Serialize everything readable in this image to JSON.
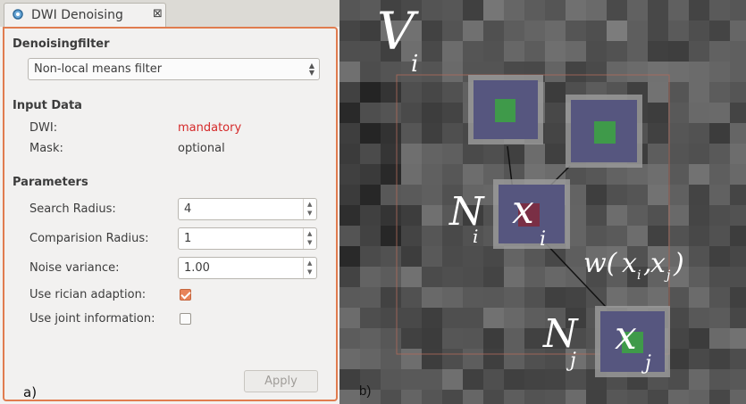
{
  "tab": {
    "title": "DWI Denoising",
    "close": "⊠"
  },
  "filter": {
    "heading": "Denoisingfilter",
    "selected": "Non-local means filter"
  },
  "input": {
    "heading": "Input Data",
    "dwi_label": "DWI:",
    "dwi_value": "mandatory",
    "mask_label": "Mask:",
    "mask_value": "optional"
  },
  "params": {
    "heading": "Parameters",
    "search_radius_label": "Search Radius:",
    "search_radius": "4",
    "comparison_radius_label": "Comparision Radius:",
    "comparison_radius": "1",
    "noise_variance_label": "Noise variance:",
    "noise_variance": "1.00",
    "rician_label": "Use rician adaption:",
    "rician_checked": true,
    "joint_label": "Use joint information:",
    "joint_checked": false
  },
  "apply_label": "Apply",
  "panel_a_label": "a)",
  "panel_b_label": "b)",
  "figure": {
    "V": "V",
    "V_sub": "i",
    "Ni": "N",
    "Ni_sub": "i",
    "xi": "x",
    "xi_sub": "i",
    "Nj": "N",
    "Nj_sub": "j",
    "xj": "x",
    "xj_sub": "j",
    "w_open": "w(",
    "w_x1": "x",
    "w_i": "i",
    "w_comma": ",",
    "w_x2": "x",
    "w_j": "j",
    "w_close": ")"
  },
  "colors": {
    "accent": "#e07c4f",
    "mandatory": "#d52a2a",
    "patch": "#5b5b8c",
    "center": "#3f9a4a"
  }
}
